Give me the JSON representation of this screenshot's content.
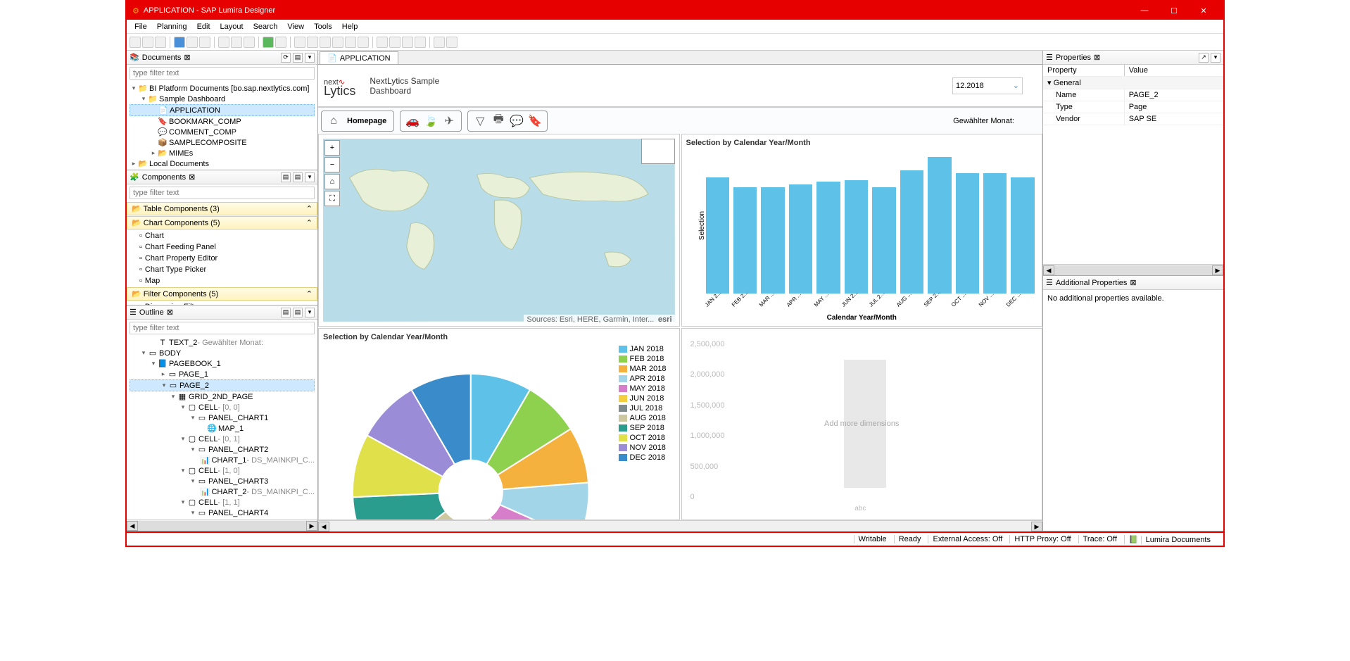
{
  "titlebar": {
    "app_icon": "⚙",
    "title": "APPLICATION - SAP Lumira Designer"
  },
  "menubar": [
    "File",
    "Planning",
    "Edit",
    "Layout",
    "Search",
    "View",
    "Tools",
    "Help"
  ],
  "panels": {
    "documents": {
      "title": "Documents",
      "filter_placeholder": "type filter text",
      "tree": [
        {
          "level": 0,
          "toggle": "▾",
          "icon": "📁",
          "label": "BI Platform Documents [bo.sap.nextlytics.com]"
        },
        {
          "level": 1,
          "toggle": "▾",
          "icon": "📁",
          "label": "Sample Dashboard"
        },
        {
          "level": 2,
          "toggle": "",
          "icon": "📄",
          "label": "APPLICATION",
          "selected": true
        },
        {
          "level": 2,
          "toggle": "",
          "icon": "🔖",
          "label": "BOOKMARK_COMP"
        },
        {
          "level": 2,
          "toggle": "",
          "icon": "💬",
          "label": "COMMENT_COMP"
        },
        {
          "level": 2,
          "toggle": "",
          "icon": "📦",
          "label": "SAMPLECOMPOSITE"
        },
        {
          "level": 2,
          "toggle": "▸",
          "icon": "📂",
          "label": "MIMEs"
        },
        {
          "level": 0,
          "toggle": "▸",
          "icon": "📂",
          "label": "Local Documents"
        }
      ]
    },
    "components": {
      "title": "Components",
      "filter_placeholder": "type filter text",
      "categories": [
        {
          "label": "Table Components (3)",
          "items": []
        },
        {
          "label": "Chart Components (5)",
          "items": [
            "Chart",
            "Chart Feeding Panel",
            "Chart Property Editor",
            "Chart Type Picker",
            "Map"
          ]
        },
        {
          "label": "Filter Components (5)",
          "items": [
            "Dimension Filter"
          ]
        }
      ]
    },
    "outline": {
      "title": "Outline",
      "filter_placeholder": "type filter text",
      "tree": [
        {
          "level": 2,
          "toggle": "",
          "icon": "T",
          "label": "TEXT_2",
          "suffix": " - Gewählter Monat:"
        },
        {
          "level": 1,
          "toggle": "▾",
          "icon": "▭",
          "label": "BODY"
        },
        {
          "level": 2,
          "toggle": "▾",
          "icon": "📘",
          "label": "PAGEBOOK_1"
        },
        {
          "level": 3,
          "toggle": "▸",
          "icon": "▭",
          "label": "PAGE_1"
        },
        {
          "level": 3,
          "toggle": "▾",
          "icon": "▭",
          "label": "PAGE_2",
          "selected": true
        },
        {
          "level": 4,
          "toggle": "▾",
          "icon": "▦",
          "label": "GRID_2ND_PAGE"
        },
        {
          "level": 5,
          "toggle": "▾",
          "icon": "▢",
          "label": "CELL",
          "suffix": " - [0, 0]"
        },
        {
          "level": 6,
          "toggle": "▾",
          "icon": "▭",
          "label": "PANEL_CHART1"
        },
        {
          "level": 7,
          "toggle": "",
          "icon": "🌐",
          "label": "MAP_1"
        },
        {
          "level": 5,
          "toggle": "▾",
          "icon": "▢",
          "label": "CELL",
          "suffix": " - [0, 1]"
        },
        {
          "level": 6,
          "toggle": "▾",
          "icon": "▭",
          "label": "PANEL_CHART2"
        },
        {
          "level": 7,
          "toggle": "",
          "icon": "📊",
          "label": "CHART_1",
          "suffix": " - DS_MAINKPI_C..."
        },
        {
          "level": 5,
          "toggle": "▾",
          "icon": "▢",
          "label": "CELL",
          "suffix": " - [1, 0]"
        },
        {
          "level": 6,
          "toggle": "▾",
          "icon": "▭",
          "label": "PANEL_CHART3"
        },
        {
          "level": 7,
          "toggle": "",
          "icon": "📊",
          "label": "CHART_2",
          "suffix": " - DS_MAINKPI_C..."
        },
        {
          "level": 5,
          "toggle": "▾",
          "icon": "▢",
          "label": "CELL",
          "suffix": " - [1, 1]"
        },
        {
          "level": 6,
          "toggle": "▾",
          "icon": "▭",
          "label": "PANEL_CHART4"
        }
      ]
    },
    "properties": {
      "title": "Properties",
      "columns": [
        "Property",
        "Value"
      ],
      "group": "General",
      "rows": [
        {
          "name": "Name",
          "value": "PAGE_2"
        },
        {
          "name": "Type",
          "value": "Page"
        },
        {
          "name": "Vendor",
          "value": "SAP SE"
        }
      ]
    },
    "additional": {
      "title": "Additional Properties",
      "message": "No additional properties available."
    }
  },
  "tab": {
    "label": "APPLICATION"
  },
  "dashboard": {
    "logo_top": "next",
    "logo_sym": "∿",
    "logo_bottom": "Lytics",
    "title_line1": "NextLytics Sample",
    "title_line2": "Dashboard",
    "selected_month": "12.2018",
    "selected_month_label": "Gewählter Monat:",
    "nav": {
      "home_label": "Homepage"
    },
    "map_attribution": "Sources: Esri, HERE, Garmin, Inter...",
    "map_esri": "esri",
    "placeholder_text": "Add more dimensions",
    "placeholder_x": "abc",
    "placeholder_yticks": [
      "2,500,000",
      "2,000,000",
      "1,500,000",
      "1,000,000",
      "500,000",
      "0"
    ]
  },
  "chart_data": [
    {
      "type": "bar",
      "title": "Selection by Calendar Year/Month",
      "xlabel": "Calendar Year/Month",
      "ylabel": "Selection",
      "categories": [
        "JAN 2...",
        "FEB 2...",
        "MAR ...",
        "APR ...",
        "MAY ...",
        "JUN 2...",
        "JUL 2...",
        "AUG ...",
        "SEP 2...",
        "OCT ...",
        "NOV ...",
        "DEC ..."
      ],
      "values": [
        85,
        78,
        78,
        80,
        82,
        83,
        78,
        90,
        100,
        88,
        88,
        85
      ]
    },
    {
      "type": "pie",
      "title": "Selection by Calendar Year/Month",
      "series": [
        {
          "name": "JAN 2018",
          "value": 8.5,
          "color": "#5ec1e8"
        },
        {
          "name": "FEB 2018",
          "value": 7.8,
          "color": "#8ed14f"
        },
        {
          "name": "MAR 2018",
          "value": 7.8,
          "color": "#f4b13e"
        },
        {
          "name": "APR 2018",
          "value": 8.0,
          "color": "#a3d5e8"
        },
        {
          "name": "MAY 2018",
          "value": 8.2,
          "color": "#d67ec9"
        },
        {
          "name": "JUN 2018",
          "value": 8.3,
          "color": "#f4d03e"
        },
        {
          "name": "JUL 2018",
          "value": 7.8,
          "color": "#7f8c8d"
        },
        {
          "name": "AUG 2018",
          "value": 9.0,
          "color": "#cdc8a0"
        },
        {
          "name": "SEP 2018",
          "value": 10.0,
          "color": "#2a9d8f"
        },
        {
          "name": "OCT 2018",
          "value": 8.8,
          "color": "#dfe04a"
        },
        {
          "name": "NOV 2018",
          "value": 8.8,
          "color": "#9b8cd8"
        },
        {
          "name": "DEC 2018",
          "value": 8.5,
          "color": "#3a8bc9"
        }
      ]
    }
  ],
  "statusbar": {
    "writable": "Writable",
    "ready": "Ready",
    "external": "External Access: Off",
    "proxy": "HTTP Proxy: Off",
    "trace": "Trace: Off",
    "docs": "Lumira Documents"
  }
}
